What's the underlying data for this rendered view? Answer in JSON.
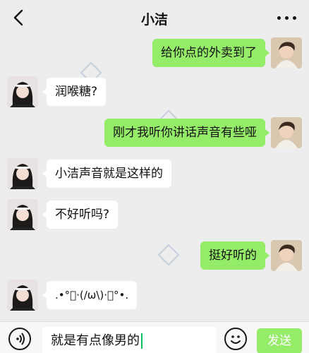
{
  "header": {
    "title": "小洁",
    "back_icon": "chevron-left-icon",
    "more_icon": "more-dots-icon"
  },
  "messages": [
    {
      "side": "out",
      "text": "给你点的外卖到了"
    },
    {
      "side": "in",
      "text": "润喉糖?"
    },
    {
      "side": "out",
      "text": "刚才我听你讲话声音有些哑"
    },
    {
      "side": "in",
      "text": "小洁声音就是这样的"
    },
    {
      "side": "in",
      "text": "不好听吗?"
    },
    {
      "side": "out",
      "text": "挺好听的"
    },
    {
      "side": "in",
      "text": ".•°ﾟ·(/ω\\)·ﾟ°•."
    }
  ],
  "input_bar": {
    "voice_icon": "voice-icon",
    "value": "就是有点像男的",
    "emoji_icon": "emoji-icon",
    "send_label": "发送"
  },
  "colors": {
    "background": "#ededed",
    "outgoing_bubble": "#95ec69",
    "incoming_bubble": "#ffffff",
    "caret": "#07c160"
  }
}
